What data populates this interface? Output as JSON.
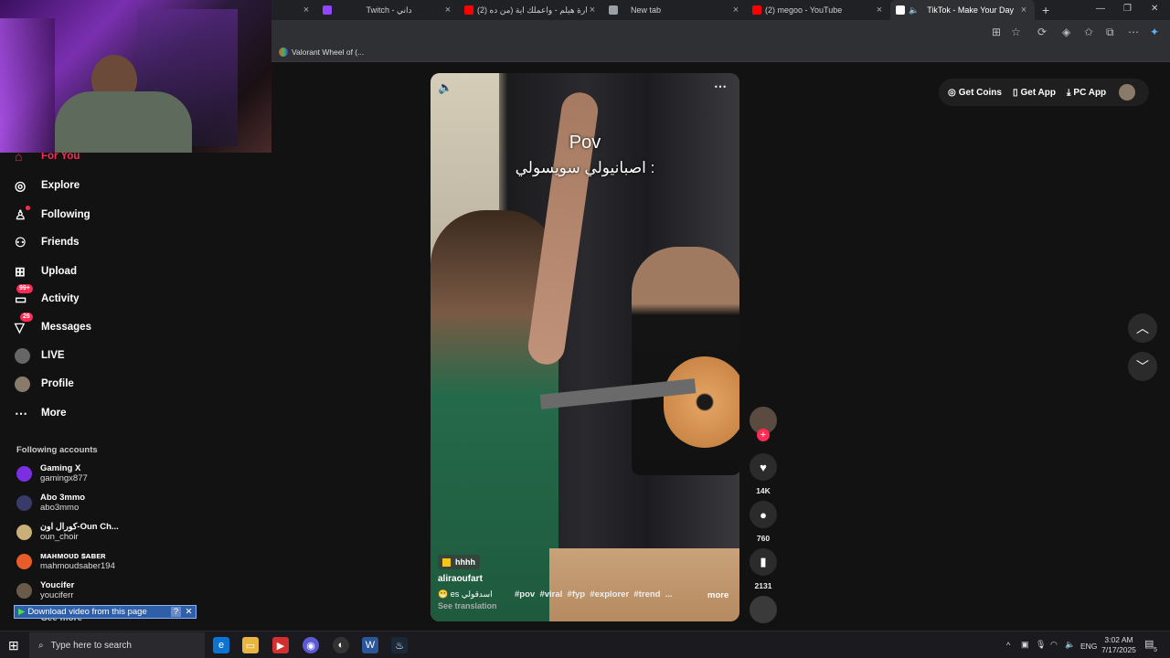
{
  "browser": {
    "tabs": [
      {
        "label": "",
        "favicon_color": "#cfcfcf"
      },
      {
        "label": "Twitch - داني",
        "favicon_color": "#9146ff"
      },
      {
        "label": "(2) سارة هيلم - واعملك اية (من ده",
        "favicon_color": "#ff0000"
      },
      {
        "label": "New tab",
        "favicon_color": "#9aa0a6"
      },
      {
        "label": "(2) megoo - YouTube",
        "favicon_color": "#ff0000"
      },
      {
        "label": "TikTok - Make Your Day",
        "favicon_color": "#ffffff",
        "active": true
      }
    ],
    "new_tab_label": "+",
    "window_controls": {
      "minimize": "—",
      "restore": "❐",
      "close": "✕"
    },
    "bookmark": {
      "label": "Valorant Wheel of (..."
    }
  },
  "sidebar": {
    "nav": [
      {
        "label": "For You",
        "icon": "home-icon"
      },
      {
        "label": "Explore",
        "icon": "compass-icon"
      },
      {
        "label": "Following",
        "icon": "user-follow-icon"
      },
      {
        "label": "Friends",
        "icon": "friends-icon"
      },
      {
        "label": "Upload",
        "icon": "upload-icon"
      },
      {
        "label": "Activity",
        "icon": "inbox-icon",
        "badge": "99+"
      },
      {
        "label": "Messages",
        "icon": "send-icon",
        "badge": "26"
      },
      {
        "label": "LIVE",
        "icon": "live-icon"
      },
      {
        "label": "Profile",
        "icon": "avatar-icon"
      },
      {
        "label": "More",
        "icon": "more-icon"
      }
    ],
    "following_title": "Following accounts",
    "accounts": [
      {
        "name": "Gaming X",
        "handle": "gamingx877",
        "color": "#7b2fe0"
      },
      {
        "name": "Abo 3mmo",
        "handle": "abo3mmo",
        "color": "#3a3a6a"
      },
      {
        "name": "كورال اون-Oun Ch...",
        "handle": "oun_choir",
        "color": "#c9b078"
      },
      {
        "name": "ᴍᴀʜᴍᴏᴜᴅ ꜱᴀʙᴇʀ",
        "handle": "mahmoudsaber194",
        "color": "#e85c2a"
      },
      {
        "name": "Youcifer",
        "handle": "youciferr",
        "color": "#6a5a4a"
      }
    ],
    "see_more": "See more",
    "download_bar": {
      "label": "Download video from this page",
      "help": "?",
      "close": "✕"
    }
  },
  "topnav": {
    "get_coins": "Get Coins",
    "get_app": "Get App",
    "pc_app": "PC App"
  },
  "video": {
    "overlay_title": "Pov",
    "overlay_caption": "اصبانيولي سويسولي :",
    "tag": "hhhh",
    "author": "aliraoufart",
    "desc_prefix": "😁 es اسدقولي",
    "hashtags": "#pov  #viral  #fyp  #explorer  #trend  ...",
    "more": "more",
    "see_translation": "See translation"
  },
  "actions": {
    "likes": "14K",
    "comments": "760",
    "saves": "2131"
  },
  "taskbar": {
    "search_placeholder": "Type here to search",
    "language": "ENG",
    "time": "3:02 AM",
    "date": "7/17/2025",
    "notification_count": "5"
  },
  "colors": {
    "accent": "#fe2c55",
    "background": "#121212"
  }
}
